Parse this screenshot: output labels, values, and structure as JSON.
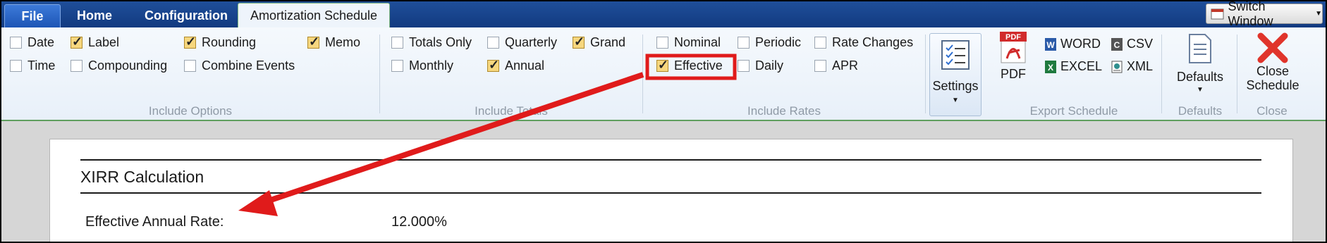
{
  "tabs": {
    "file": "File",
    "home": "Home",
    "configuration": "Configuration",
    "amortization": "Amortization Schedule",
    "switch_window": "Switch Window"
  },
  "include_options": {
    "group_label": "Include Options",
    "date": {
      "label": "Date",
      "checked": false
    },
    "time": {
      "label": "Time",
      "checked": false
    },
    "label": {
      "label": "Label",
      "checked": true
    },
    "compounding": {
      "label": "Compounding",
      "checked": false
    },
    "rounding": {
      "label": "Rounding",
      "checked": true
    },
    "combine_events": {
      "label": "Combine Events",
      "checked": false
    },
    "memo": {
      "label": "Memo",
      "checked": true
    }
  },
  "include_totals": {
    "group_label": "Include Totals",
    "totals_only": {
      "label": "Totals Only",
      "checked": false
    },
    "monthly": {
      "label": "Monthly",
      "checked": false
    },
    "quarterly": {
      "label": "Quarterly",
      "checked": false
    },
    "annual": {
      "label": "Annual",
      "checked": true
    },
    "grand": {
      "label": "Grand",
      "checked": true
    }
  },
  "include_rates": {
    "group_label": "Include Rates",
    "nominal": {
      "label": "Nominal",
      "checked": false
    },
    "effective": {
      "label": "Effective",
      "checked": true
    },
    "periodic": {
      "label": "Periodic",
      "checked": false
    },
    "daily": {
      "label": "Daily",
      "checked": false
    },
    "rate_changes": {
      "label": "Rate Changes",
      "checked": false
    },
    "apr": {
      "label": "APR",
      "checked": false
    }
  },
  "settings": {
    "label": "Settings"
  },
  "export": {
    "group_label": "Export Schedule",
    "pdf": "PDF",
    "word": "WORD",
    "excel": "EXCEL",
    "csv": "CSV",
    "xml": "XML"
  },
  "defaults": {
    "label": "Defaults",
    "group_label": "Defaults"
  },
  "close": {
    "label_line1": "Close",
    "label_line2": "Schedule",
    "group_label": "Close"
  },
  "document": {
    "title": "XIRR Calculation",
    "effective_label": "Effective Annual Rate:",
    "effective_value": "12.000%"
  },
  "colors": {
    "tabbar": "#1a4690",
    "checked_box": "#f6d77e",
    "annotation": "#e01b1b"
  }
}
